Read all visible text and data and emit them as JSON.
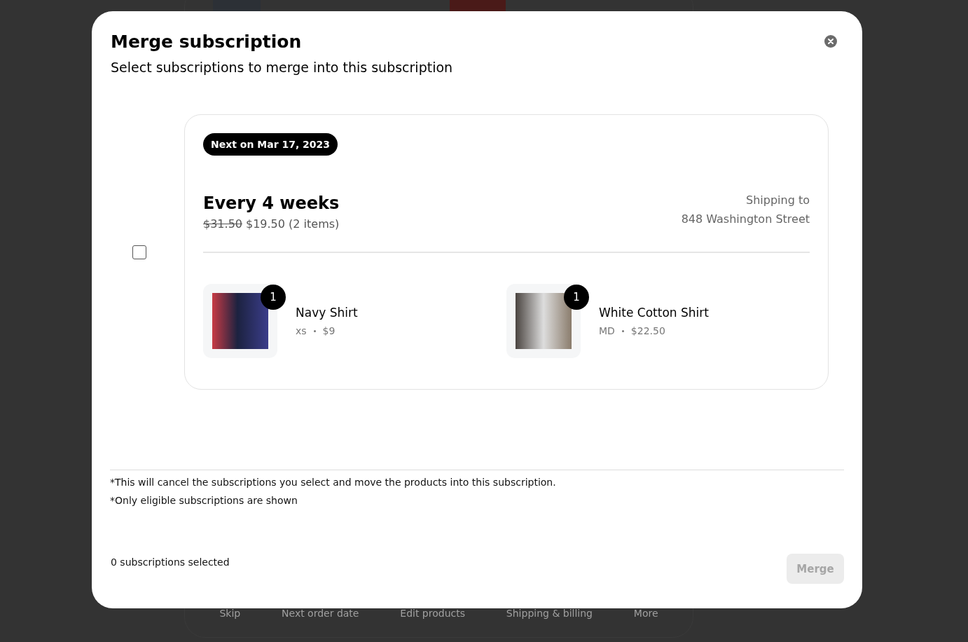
{
  "background": {
    "nav": [
      "Skip",
      "Next order date",
      "Edit products",
      "Shipping & billing",
      "More"
    ]
  },
  "dialog": {
    "title": "Merge subscription",
    "subtitle": "Select subscriptions to merge into this subscription",
    "subscriptions": [
      {
        "checked": false,
        "badge": "Next on Mar 17, 2023",
        "frequency": "Every 4 weeks",
        "old_price": "$31.50",
        "price": "$19.50 (2 items)",
        "shipping_label": "Shipping to",
        "address": "848 Washington Street",
        "products": [
          {
            "name": "Navy Shirt",
            "quantity": "1",
            "variant": "xs",
            "price": "$9"
          },
          {
            "name": "White Cotton Shirt",
            "quantity": "1",
            "variant": "MD",
            "price": "$22.50"
          }
        ]
      }
    ],
    "notes": [
      "*This will cancel the subscriptions you select and move the products into this subscription.",
      "*Only eligible subscriptions are shown"
    ],
    "selected_count": "0 subscriptions selected",
    "merge_button": {
      "label": "Merge",
      "disabled": true
    }
  }
}
